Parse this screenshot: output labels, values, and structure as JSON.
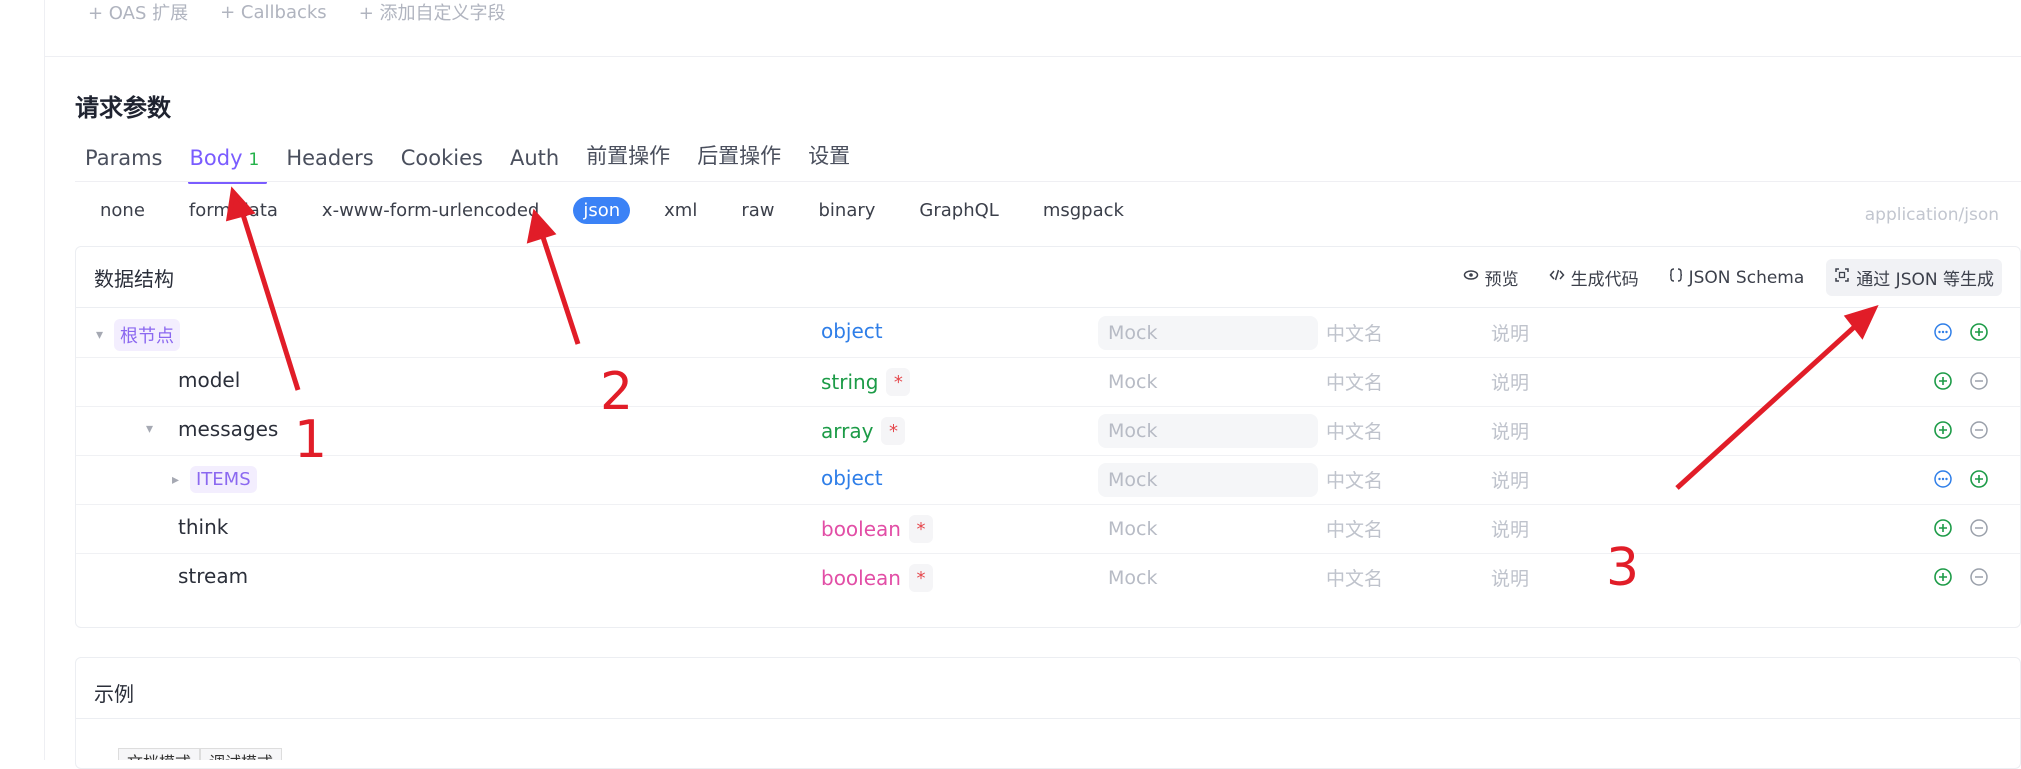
{
  "top_actions": [
    "+ OAS 扩展",
    "+ Callbacks",
    "+ 添加自定义字段"
  ],
  "section_title": "请求参数",
  "tabs": [
    {
      "label": "Params"
    },
    {
      "label": "Body",
      "badge": "1"
    },
    {
      "label": "Headers"
    },
    {
      "label": "Cookies"
    },
    {
      "label": "Auth"
    },
    {
      "label": "前置操作"
    },
    {
      "label": "后置操作"
    },
    {
      "label": "设置"
    }
  ],
  "body_types": [
    "none",
    "form-data",
    "x-www-form-urlencoded",
    "json",
    "xml",
    "raw",
    "binary",
    "GraphQL",
    "msgpack"
  ],
  "active_body_type": "json",
  "content_type": "application/json",
  "panel": {
    "title": "数据结构",
    "actions": [
      {
        "label": "预览"
      },
      {
        "label": "生成代码"
      },
      {
        "label": "JSON Schema"
      },
      {
        "label": "通过 JSON 等生成"
      }
    ]
  },
  "rows": [
    {
      "name": "根节点",
      "type": "object",
      "required": "",
      "mock": "Mock",
      "cname": "中文名",
      "desc": "说明"
    },
    {
      "name": "model",
      "type": "string",
      "required": "*",
      "mock": "Mock",
      "cname": "中文名",
      "desc": "说明"
    },
    {
      "name": "messages",
      "type": "array",
      "required": "*",
      "mock": "Mock",
      "cname": "中文名",
      "desc": "说明"
    },
    {
      "name": "ITEMS",
      "type": "object",
      "required": "",
      "mock": "Mock",
      "cname": "中文名",
      "desc": "说明"
    },
    {
      "name": "think",
      "type": "boolean",
      "required": "*",
      "mock": "Mock",
      "cname": "中文名",
      "desc": "说明"
    },
    {
      "name": "stream",
      "type": "boolean",
      "required": "*",
      "mock": "Mock",
      "cname": "中文名",
      "desc": "说明"
    }
  ],
  "example_title": "示例",
  "bottom_modes": [
    "文档模式",
    "调试模式"
  ],
  "annotations": [
    "1",
    "2",
    "3"
  ],
  "colors": {
    "accent": "#7a5cff",
    "json_pill": "#3b82f6",
    "annotation": "#e11d28"
  }
}
